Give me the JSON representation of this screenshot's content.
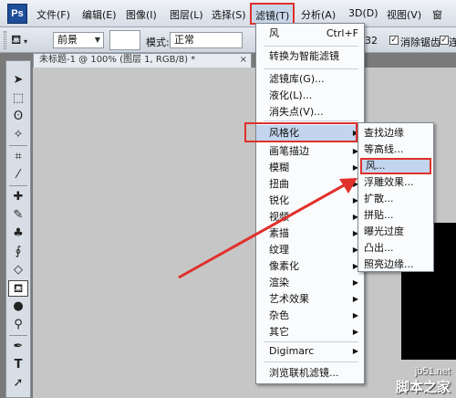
{
  "app": {
    "logo": "Ps"
  },
  "menubar": {
    "file": "文件(F)",
    "edit": "编辑(E)",
    "image": "图像(I)",
    "layer": "图层(L)",
    "select": "选择(S)",
    "filter": "滤镜(T)",
    "analysis": "分析(A)",
    "threed": "3D(D)",
    "view": "视图(V)",
    "window": "窗"
  },
  "options": {
    "fill_source": "前景",
    "mode_label": "模式:",
    "mode_value": "正常",
    "tolerance_value": "32",
    "antialias_label": "消除锯齿",
    "contiguous_label": "连",
    "antialias_checked": true,
    "contiguous_checked": true
  },
  "document": {
    "tab_title": "未标题-1 @ 100% (图层 1, RGB/8) *",
    "close": "×"
  },
  "filter_menu": {
    "wind": "风",
    "wind_shortcut": "Ctrl+F",
    "convert_smart": "转换为智能滤镜",
    "gallery": "滤镜库(G)...",
    "liquify": "液化(L)...",
    "vanishing": "消失点(V)...",
    "stylize": "风格化",
    "brush_strokes": "画笔描边",
    "blur": "模糊",
    "distort": "扭曲",
    "sharpen": "锐化",
    "video": "视频",
    "sketch": "素描",
    "texture": "纹理",
    "pixelate": "像素化",
    "render": "渲染",
    "artistic": "艺术效果",
    "noise": "杂色",
    "other": "其它",
    "digimarc": "Digimarc",
    "browse_online": "浏览联机滤镜..."
  },
  "stylize_submenu": {
    "find_edges": "查找边缘",
    "contour": "等高线...",
    "wind": "风...",
    "emboss": "浮雕效果...",
    "diffuse": "扩散...",
    "tiles": "拼贴...",
    "solarize": "曝光过度",
    "extrude": "凸出...",
    "glowing_edges": "照亮边缘..."
  },
  "watermark": {
    "url": "jb51.net",
    "name": "脚本之家"
  },
  "colors": {
    "highlight_border": "#e0302c",
    "menu_highlight": "#c3d5ee",
    "arrow": "#e0302c"
  }
}
